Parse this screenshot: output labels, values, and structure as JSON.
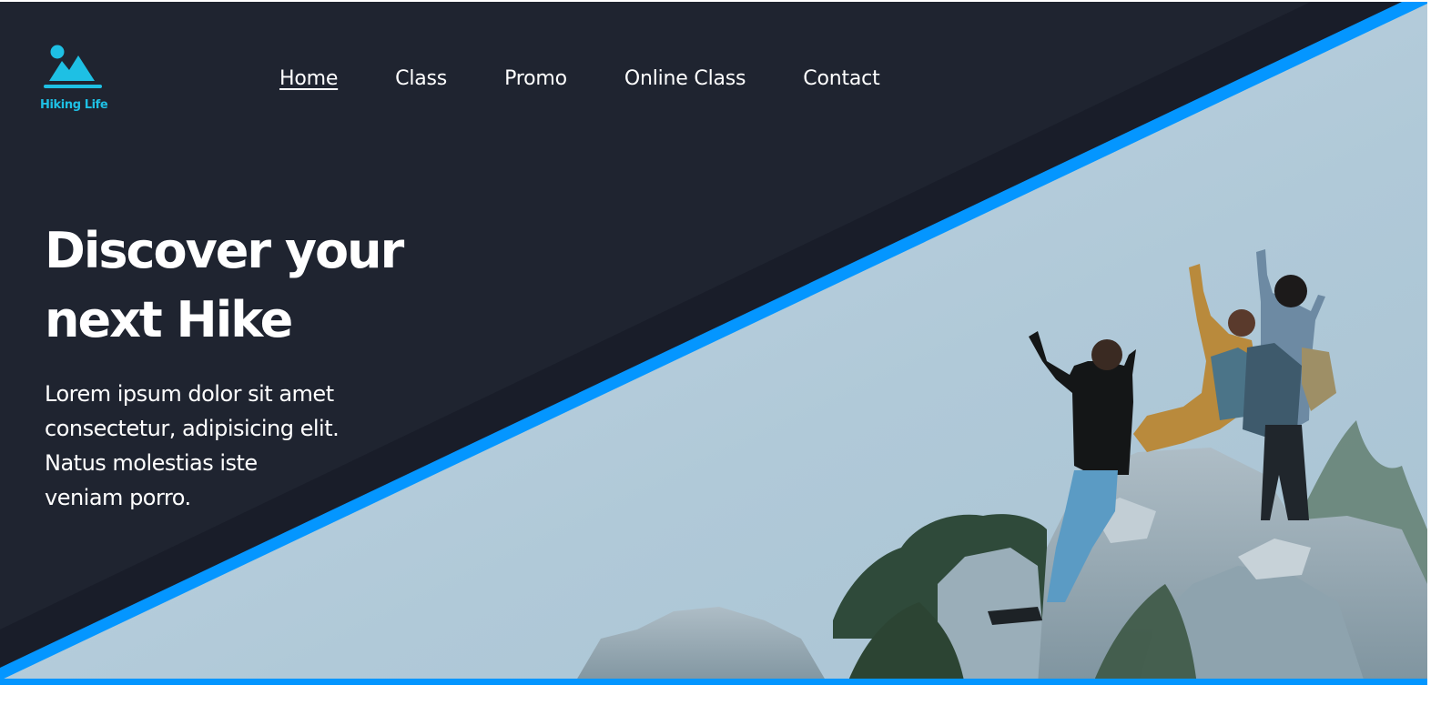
{
  "brand": {
    "name": "Hiking Life",
    "accent_color": "#1ec0e4",
    "logo_icon": "mountain-sun-icon"
  },
  "nav": {
    "items": [
      {
        "label": "Home",
        "active": true
      },
      {
        "label": "Class",
        "active": false
      },
      {
        "label": "Promo",
        "active": false
      },
      {
        "label": "Online Class",
        "active": false
      },
      {
        "label": "Contact",
        "active": false
      }
    ]
  },
  "hero": {
    "title_line1": "Discover your",
    "title_line2": "next Hike",
    "description_line1": "Lorem ipsum dolor sit amet",
    "description_line2": "consectetur, adipisicing elit.",
    "description_line3": "Natus molestias iste",
    "description_line4": "veniam porro.",
    "image": "hikers-on-rocks-photo"
  },
  "colors": {
    "dark_panel": "#1f2430",
    "dark_band": "#191d29",
    "stripe_blue": "#0496ff",
    "sky": "#b8cedb",
    "text": "#ffffff"
  }
}
